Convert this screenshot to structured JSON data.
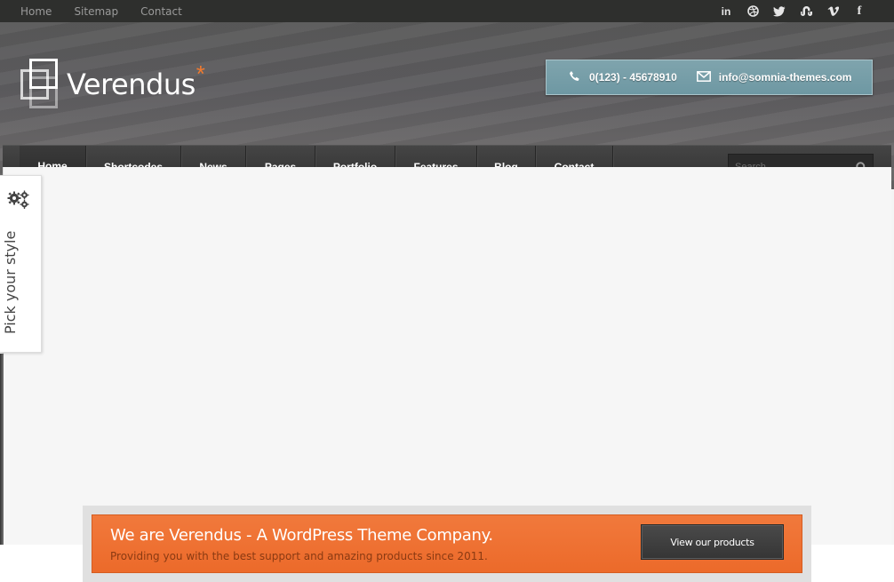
{
  "topbar": {
    "links": [
      "Home",
      "Sitemap",
      "Contact"
    ],
    "social": [
      {
        "icon": "linkedin-icon",
        "glyph": "in"
      },
      {
        "icon": "dribbble-icon",
        "glyph": "◎"
      },
      {
        "icon": "twitter-icon",
        "glyph": "🐦"
      },
      {
        "icon": "stumbleupon-icon",
        "glyph": "su"
      },
      {
        "icon": "vimeo-icon",
        "glyph": "v"
      },
      {
        "icon": "facebook-icon",
        "glyph": "f"
      }
    ]
  },
  "header": {
    "logo_text": "Verendus",
    "logo_star": "*",
    "phone": "0(123) - 45678910",
    "email": "info@somnia-themes.com"
  },
  "nav": {
    "items": [
      {
        "label": "Home",
        "active": true
      },
      {
        "label": "Shortcodes",
        "active": false
      },
      {
        "label": "News",
        "active": false
      },
      {
        "label": "Pages",
        "active": false
      },
      {
        "label": "Portfolio",
        "active": false
      },
      {
        "label": "Features",
        "active": false
      },
      {
        "label": "Blog",
        "active": false
      },
      {
        "label": "Contact",
        "active": false
      }
    ],
    "search_placeholder": "Search..."
  },
  "style_panel": {
    "label": "Pick your style"
  },
  "promo": {
    "title": "We are Verendus - A WordPress Theme Company.",
    "subtitle": "Providing you with the best support and amazing products since 2011.",
    "button_label": "View our products"
  },
  "colors": {
    "accent": "#f07a2f",
    "contact_box": "#7fa4ad",
    "nav_bg": "#3a3a3a"
  }
}
